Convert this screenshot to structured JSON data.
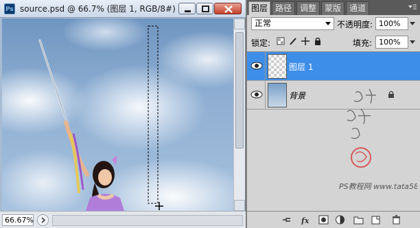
{
  "document": {
    "app_icon": "Ps",
    "title": "source.psd @ 66.7% (图层 1, RGB/8#) *",
    "zoom": "66.67%"
  },
  "panel": {
    "tabs": [
      "图层",
      "路径",
      "调整",
      "蒙版",
      "通道"
    ],
    "active_tab": "图层",
    "blend_mode": "正常",
    "opacity_label": "不透明度:",
    "opacity": "100%",
    "lock_label": "锁定:",
    "fill_label": "填充:",
    "fill": "100%",
    "layers": [
      {
        "name": "图层 1",
        "selected": true,
        "visible": true,
        "thumb": "transparent"
      },
      {
        "name": "背景",
        "selected": false,
        "visible": true,
        "locked": true,
        "thumb": "image"
      }
    ],
    "footer_icons": [
      "link-icon",
      "fx-icon",
      "mask-icon",
      "adjustment-icon",
      "group-icon",
      "new-layer-icon",
      "trash-icon"
    ]
  },
  "watermark": {
    "text": "PS教程网 www.tata580.com"
  },
  "colors": {
    "selection": "#3d8ee8",
    "panel_bg": "#d4d4d4",
    "close_button": "#c3412b"
  }
}
